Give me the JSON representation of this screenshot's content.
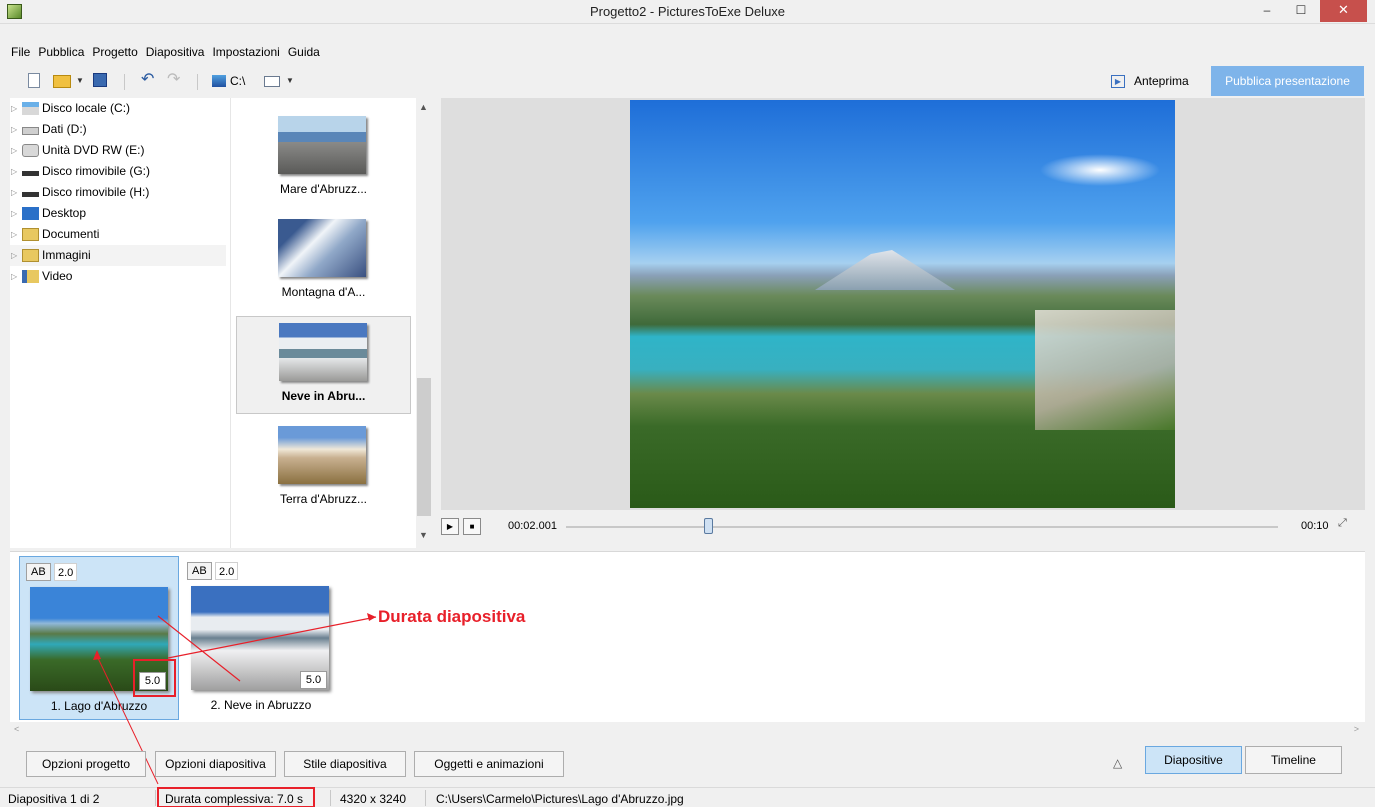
{
  "window": {
    "title": "Progetto2 - PicturesToExe Deluxe",
    "minimize": "–",
    "maximize": "☐",
    "close": "✕"
  },
  "menu": [
    "File",
    "Pubblica",
    "Progetto",
    "Diapositiva",
    "Impostazioni",
    "Guida"
  ],
  "toolbar": {
    "drive_label": "C:\\",
    "preview_label": "Anteprima",
    "publish_label": "Pubblica presentazione"
  },
  "tree": [
    {
      "label": "Disco locale (C:)",
      "icon": "local-disk-icon"
    },
    {
      "label": "Dati (D:)",
      "icon": "hard-drive-icon"
    },
    {
      "label": "Unità DVD RW (E:)",
      "icon": "dvd-drive-icon"
    },
    {
      "label": "Disco rimovibile (G:)",
      "icon": "removable-disk-icon"
    },
    {
      "label": "Disco rimovibile (H:)",
      "icon": "removable-disk-icon"
    },
    {
      "label": "Desktop",
      "icon": "desktop-icon"
    },
    {
      "label": "Documenti",
      "icon": "documents-folder-icon"
    },
    {
      "label": "Immagini",
      "icon": "pictures-folder-icon",
      "selected": true
    },
    {
      "label": "Video",
      "icon": "video-folder-icon"
    }
  ],
  "file_thumbs": [
    {
      "caption": "Mare d'Abruzz..."
    },
    {
      "caption": "Montagna d'A..."
    },
    {
      "caption": "Neve in Abru...",
      "selected": true
    },
    {
      "caption": "Terra d'Abruzz..."
    }
  ],
  "playback": {
    "current_time": "00:02.001",
    "end_time": "00:10",
    "progress": 0.2
  },
  "slides": [
    {
      "transition": "AB",
      "transition_duration": "2.0",
      "duration": "5.0",
      "caption": "1. Lago d'Abruzzo",
      "selected": true
    },
    {
      "transition": "AB",
      "transition_duration": "2.0",
      "duration": "5.0",
      "caption": "2. Neve in Abruzzo"
    }
  ],
  "annotation": {
    "label": "Durata diapositiva",
    "color": "#e8202a"
  },
  "buttons": {
    "project_options": "Opzioni progetto",
    "slide_options": "Opzioni diapositiva",
    "slide_style": "Stile diapositiva",
    "objects": "Oggetti e animazioni",
    "tab_slides": "Diapositive",
    "tab_timeline": "Timeline"
  },
  "status": {
    "slide_index": "Diapositiva 1 di 2",
    "total_duration": "Durata complessiva: 7.0 s",
    "resolution": "4320 x 3240",
    "path": "C:\\Users\\Carmelo\\Pictures\\Lago d'Abruzzo.jpg"
  },
  "colors": {
    "accent": "#7eb4ea",
    "selection": "#cce4f7",
    "annotation": "#e8202a"
  }
}
